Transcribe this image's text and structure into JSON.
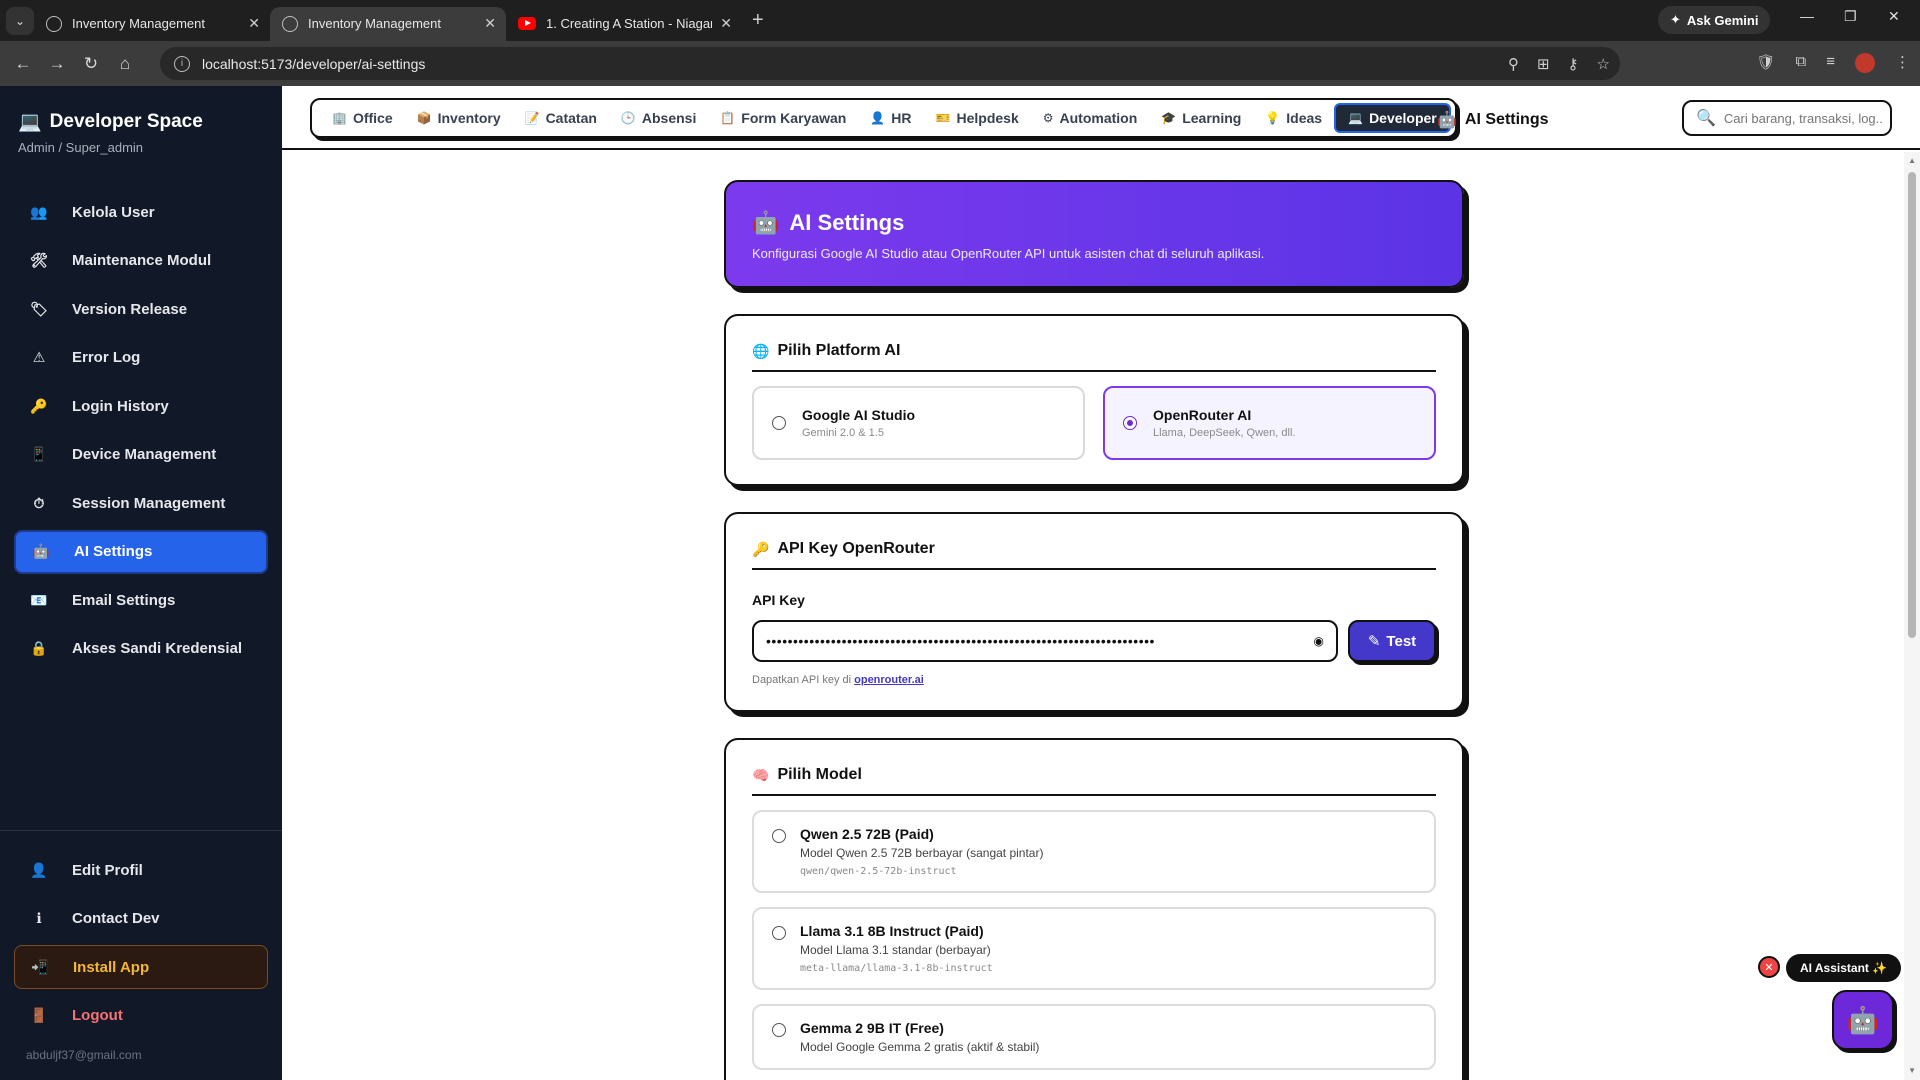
{
  "browser": {
    "tabs": [
      {
        "title": "Inventory Management",
        "active": false
      },
      {
        "title": "Inventory Management",
        "active": true
      },
      {
        "title": "1. Creating A Station - Niagara",
        "active": false
      }
    ],
    "ask_gemini": "Ask Gemini",
    "url": "localhost:5173/developer/ai-settings"
  },
  "sidebar": {
    "title": "Developer Space",
    "subtitle": "Admin / Super_admin",
    "items": [
      {
        "label": "Kelola User",
        "icon": "users-icon",
        "glyph": "👥"
      },
      {
        "label": "Maintenance Modul",
        "icon": "tools-icon",
        "glyph": "🛠"
      },
      {
        "label": "Version Release",
        "icon": "tag-icon",
        "glyph": "🏷"
      },
      {
        "label": "Error Log",
        "icon": "warning-icon",
        "glyph": "⚠"
      },
      {
        "label": "Login History",
        "icon": "key-icon",
        "glyph": "🔑"
      },
      {
        "label": "Device Management",
        "icon": "device-icon",
        "glyph": "📱"
      },
      {
        "label": "Session Management",
        "icon": "stopwatch-icon",
        "glyph": "⏱"
      },
      {
        "label": "AI Settings",
        "icon": "robot-icon",
        "glyph": "🤖"
      },
      {
        "label": "Email Settings",
        "icon": "email-icon",
        "glyph": "📧"
      },
      {
        "label": "Akses Sandi Kredensial",
        "icon": "lock-icon",
        "glyph": "🔒"
      }
    ],
    "active_index": 7,
    "bottom": {
      "edit_profile": "Edit Profil",
      "contact_dev": "Contact Dev",
      "install_app": "Install App",
      "logout": "Logout"
    },
    "email": "abduljf37@gmail.com"
  },
  "topnav": {
    "modules": [
      {
        "label": "Office",
        "glyph": "🏢"
      },
      {
        "label": "Inventory",
        "glyph": "📦"
      },
      {
        "label": "Catatan",
        "glyph": "📝"
      },
      {
        "label": "Absensi",
        "glyph": "🕒"
      },
      {
        "label": "Form Karyawan",
        "glyph": "📋"
      },
      {
        "label": "HR",
        "glyph": "👤"
      },
      {
        "label": "Helpdesk",
        "glyph": "🎫"
      },
      {
        "label": "Automation",
        "glyph": "⚙"
      },
      {
        "label": "Learning",
        "glyph": "🎓"
      },
      {
        "label": "Ideas",
        "glyph": "💡"
      },
      {
        "label": "Developer",
        "glyph": "💻"
      }
    ],
    "active_module": "Developer",
    "breadcrumb": "AI Settings",
    "search_placeholder": "Cari barang, transaksi, log..."
  },
  "hero": {
    "title": "AI Settings",
    "subtitle": "Konfigurasi Google AI Studio atau OpenRouter API untuk asisten chat di seluruh aplikasi."
  },
  "platform": {
    "title": "Pilih Platform AI",
    "options": [
      {
        "name": "Google AI Studio",
        "desc": "Gemini 2.0 & 1.5",
        "selected": false
      },
      {
        "name": "OpenRouter AI",
        "desc": "Llama, DeepSeek, Qwen, dll.",
        "selected": true
      }
    ]
  },
  "api_key": {
    "title": "API Key OpenRouter",
    "label": "API Key",
    "value": "••••••••••••••••••••••••••••••••••••••••••••••••••••••••••••••••••••••••",
    "test_label": "Test",
    "hint_prefix": "Dapatkan API key di",
    "hint_link": "openrouter.ai"
  },
  "models": {
    "title": "Pilih Model",
    "items": [
      {
        "name": "Qwen 2.5 72B (Paid)",
        "desc": "Model Qwen 2.5 72B berbayar (sangat pintar)",
        "id": "qwen/qwen-2.5-72b-instruct"
      },
      {
        "name": "Llama 3.1 8B Instruct (Paid)",
        "desc": "Model Llama 3.1 standar (berbayar)",
        "id": "meta-llama/llama-3.1-8b-instruct"
      },
      {
        "name": "Gemma 2 9B IT (Free)",
        "desc": "Model Google Gemma 2 gratis (aktif & stabil)",
        "id": ""
      }
    ]
  },
  "assistant": {
    "label": "AI Assistant ✨"
  }
}
